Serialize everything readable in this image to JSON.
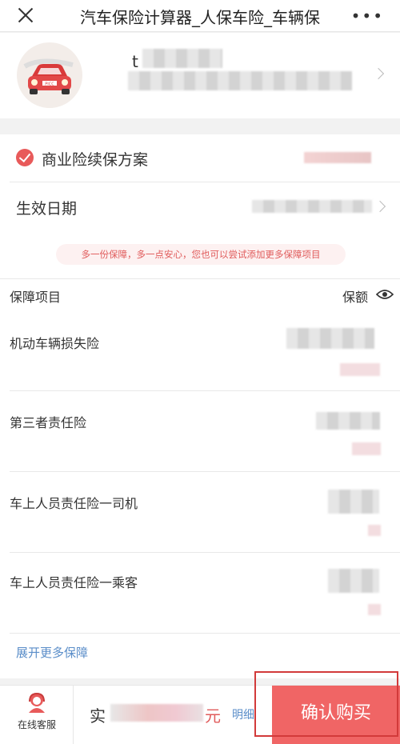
{
  "header": {
    "title": "汽车保险计算器_人保车险_车辆保",
    "more_label": "•••"
  },
  "profile": {
    "name_initial": "t"
  },
  "plan": {
    "title": "商业险续保方案"
  },
  "effective_date": {
    "label": "生效日期"
  },
  "notice": "多一份保障，多一点安心，您也可以尝试添加更多保障项目",
  "coverage": {
    "header_label": "保障项目",
    "amount_label": "保额",
    "items": [
      {
        "name": "机动车辆损失险"
      },
      {
        "name": "第三者责任险"
      },
      {
        "name": "车上人员责任险一司机"
      },
      {
        "name": "车上人员责任险一乘客"
      }
    ]
  },
  "expand_label": "展开更多保障",
  "bottom": {
    "service_label": "在线客服",
    "pay_prefix": "实",
    "unit": "元",
    "detail_label": "明细",
    "buy_label": "确认购买"
  },
  "colors": {
    "accent": "#f06565",
    "link": "#5b8ec9"
  }
}
